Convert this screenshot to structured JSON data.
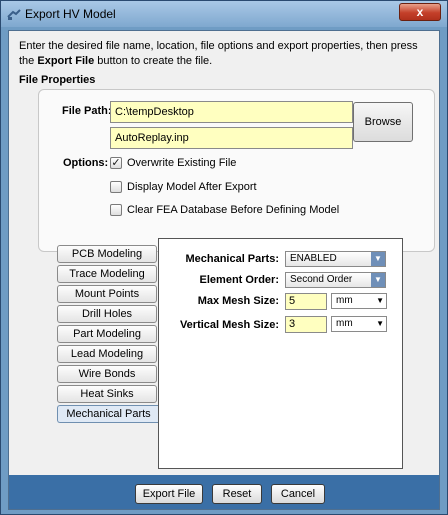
{
  "window": {
    "title": "Export HV Model",
    "close_label": "x"
  },
  "description": {
    "line1": "Enter the desired file name, location, file options and export properties, then press",
    "line2_prefix": "the ",
    "line2_bold": "Export File",
    "line2_suffix": " button to create the file."
  },
  "file_properties": {
    "section_title": "File Properties",
    "path_label": "File Path:",
    "path_value": "C:\\tempDesktop",
    "filename_value": "AutoReplay.inp",
    "browse_label": "Browse",
    "options_label": "Options:",
    "options": [
      {
        "label": "Overwrite Existing File",
        "checked": true
      },
      {
        "label": "Display Model After Export",
        "checked": false
      },
      {
        "label": "Clear FEA Database Before Defining Model",
        "checked": false
      }
    ]
  },
  "tabs": [
    {
      "label": "PCB Modeling"
    },
    {
      "label": "Trace Modeling"
    },
    {
      "label": "Mount Points"
    },
    {
      "label": "Drill Holes"
    },
    {
      "label": "Part Modeling"
    },
    {
      "label": "Lead Modeling"
    },
    {
      "label": "Wire Bonds"
    },
    {
      "label": "Heat Sinks"
    },
    {
      "label": "Mechanical Parts",
      "active": true
    }
  ],
  "mechanical": {
    "parts_label": "Mechanical Parts:",
    "parts_value": "ENABLED",
    "order_label": "Element Order:",
    "order_value": "Second Order",
    "max_mesh_label": "Max Mesh Size:",
    "max_mesh_value": "5",
    "max_mesh_unit": "mm",
    "vert_mesh_label": "Vertical Mesh Size:",
    "vert_mesh_value": "3",
    "vert_mesh_unit": "mm"
  },
  "buttons": {
    "export": "Export File",
    "reset": "Reset",
    "cancel": "Cancel"
  }
}
